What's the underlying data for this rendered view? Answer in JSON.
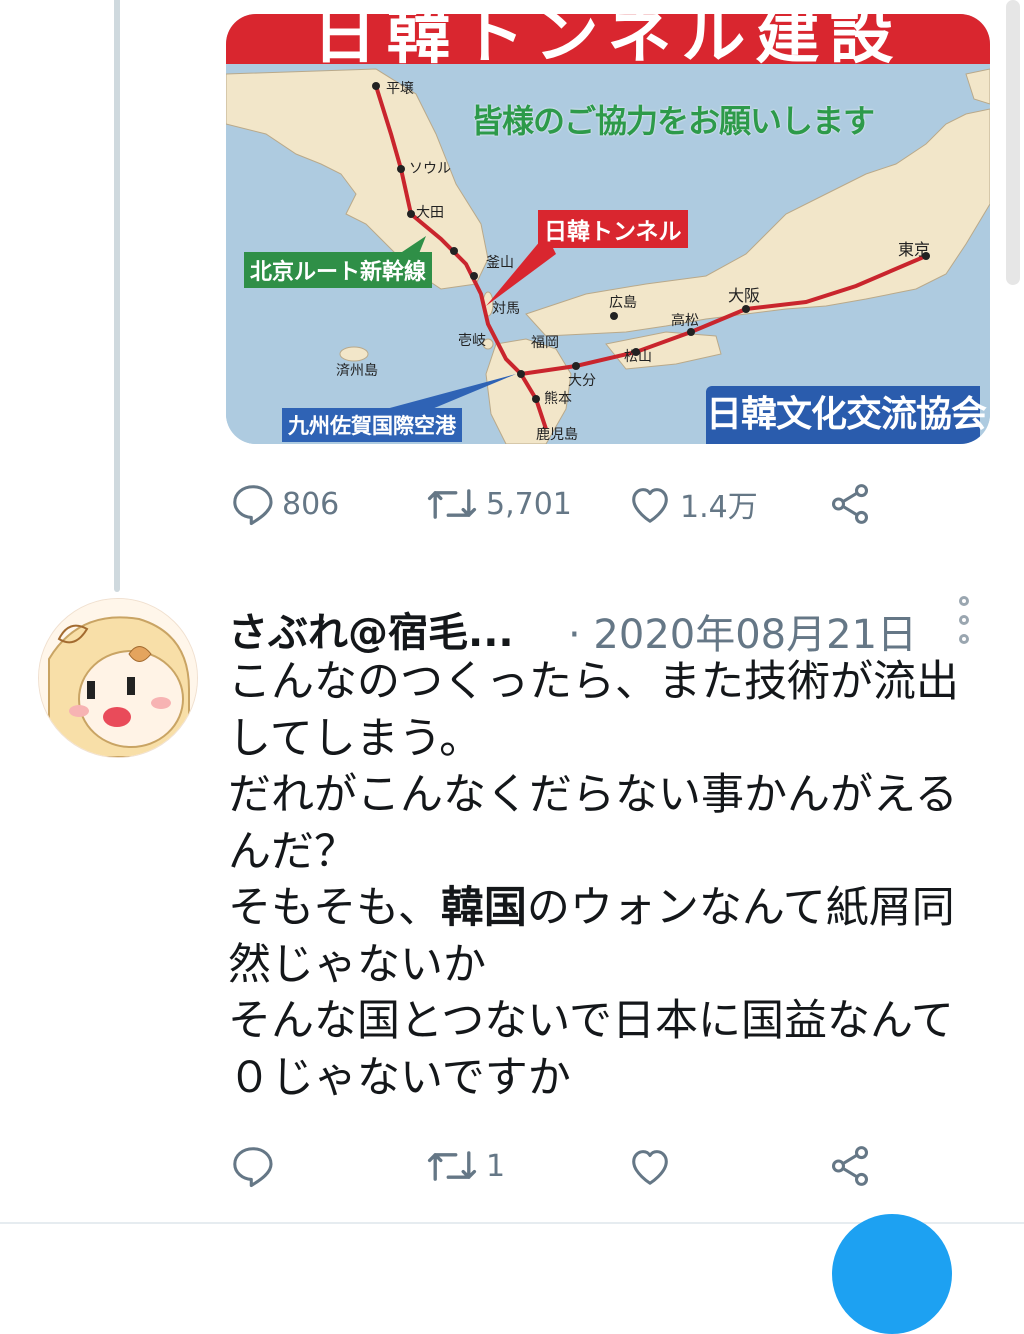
{
  "media": {
    "banner": "日韓トンネル建設",
    "subtitle": "皆様のご協力をお願いします",
    "tunnel_label": "日韓トンネル",
    "beijing_route_label": "北京ルート新幹線",
    "airport_label": "九州佐賀国際空港",
    "organization": "日韓文化交流協会",
    "cities": {
      "pyongyang": "平壌",
      "seoul": "ソウル",
      "daejeon": "大田",
      "busan": "釜山",
      "tsushima": "対馬",
      "iki": "壱岐",
      "fukuoka": "福岡",
      "jeju": "済州島",
      "kumamoto": "熊本",
      "oita": "大分",
      "kagoshima": "鹿児島",
      "hiroshima": "広島",
      "takamatsu": "高松",
      "matsuyama": "松山",
      "osaka": "大阪",
      "tokyo": "東京"
    }
  },
  "original_tweet_actions": {
    "reply_count": "806",
    "retweet_count": "5,701",
    "like_count": "1.4万"
  },
  "reply_tweet": {
    "username": "さぶれ@宿毛...",
    "date": "· 2020年08月21日",
    "text_lines": [
      "こんなのつくったら、また技術が流出",
      "してしまう。",
      "だれがこんなくだらない事かんがえる",
      "んだ？"
    ],
    "line5_before": "そもそも、",
    "line5_bold": "韓国",
    "line5_after": "のウォンなんて紙屑同",
    "text_lines_tail": [
      "然じゃないか",
      "そんな国とつないで日本に国益なんて",
      "０じゃないですか"
    ],
    "actions": {
      "reply_count": "",
      "retweet_count": "1",
      "like_count": ""
    }
  },
  "colors": {
    "icon_gray": "#657786",
    "twitter_blue": "#1da1f2",
    "banner_red": "#d9262f"
  }
}
